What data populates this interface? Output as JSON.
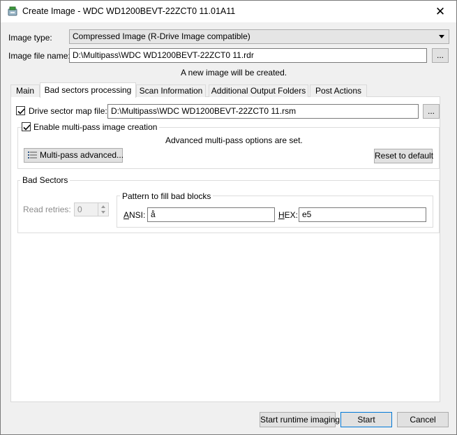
{
  "window": {
    "title": "Create Image - WDC WD1200BEVT-22ZCT0 11.01A11",
    "close_glyph": "✕"
  },
  "image_type": {
    "label": "Image type:",
    "value": "Compressed Image (R-Drive Image compatible)"
  },
  "image_file": {
    "label": "Image file name:",
    "value": "D:\\Multipass\\WDC WD1200BEVT-22ZCT0 11.rdr",
    "browse_label": "..."
  },
  "status_text": "A new image will be created.",
  "tabs": [
    {
      "label": "Main"
    },
    {
      "label": "Bad sectors processing",
      "active": true
    },
    {
      "label": "Scan Information"
    },
    {
      "label": "Additional Output Folders"
    },
    {
      "label": "Post Actions"
    }
  ],
  "bad_sectors_tab": {
    "drive_sector_map": {
      "checked": true,
      "label": "Drive sector map file:",
      "value": "D:\\Multipass\\WDC WD1200BEVT-22ZCT0 11.rsm",
      "browse_label": "..."
    },
    "multipass": {
      "checked": true,
      "label": "Enable multi-pass image creation",
      "info": "Advanced multi-pass options are set.",
      "advanced_button": "Multi-pass advanced...",
      "reset_button": "Reset to default"
    },
    "bad_sectors_group": {
      "title": "Bad Sectors",
      "read_retries_label": "Read retries:",
      "read_retries_value": "0",
      "pattern_group_title": "Pattern to fill bad blocks",
      "ansi_label_underlined": "A",
      "ansi_label_rest": "NSI:",
      "ansi_value": "å",
      "hex_label_underlined": "H",
      "hex_label_rest": "EX:",
      "hex_value": "e5"
    }
  },
  "footer": {
    "runtime_button": "Start runtime imaging",
    "start_button": "Start",
    "cancel_button": "Cancel"
  },
  "colors": {
    "focus_border": "#0078d7",
    "button_face": "#e1e1e1",
    "window_bg": "#f0f0f0"
  }
}
